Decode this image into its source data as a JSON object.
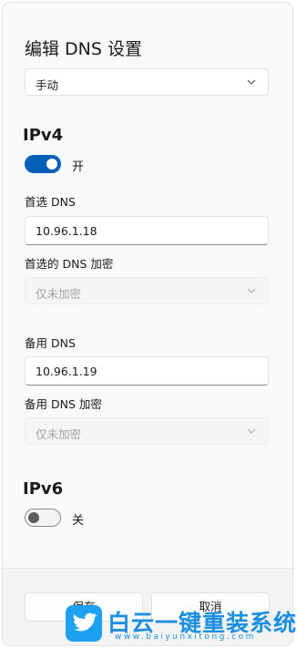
{
  "dialog": {
    "title": "编辑 DNS 设置",
    "mode_select": {
      "value": "手动"
    }
  },
  "ipv4": {
    "heading": "IPv4",
    "toggle": {
      "state": "on",
      "label": "开"
    },
    "preferred_dns": {
      "label": "首选 DNS",
      "value": "10.96.1.18"
    },
    "preferred_encryption": {
      "label": "首选的 DNS 加密",
      "value": "仅未加密"
    },
    "alternate_dns": {
      "label": "备用 DNS",
      "value": "10.96.1.19"
    },
    "alternate_encryption": {
      "label": "备用 DNS 加密",
      "value": "仅未加密"
    }
  },
  "ipv6": {
    "heading": "IPv6",
    "toggle": {
      "state": "off",
      "label": "关"
    }
  },
  "footer": {
    "save_label": "保存",
    "cancel_label": "取消"
  },
  "watermark": {
    "name": "白云一键重装系统",
    "url": "www.baiyunxitong.com"
  },
  "colors": {
    "accent": "#005fb8",
    "watermark": "#1d8fe0"
  }
}
